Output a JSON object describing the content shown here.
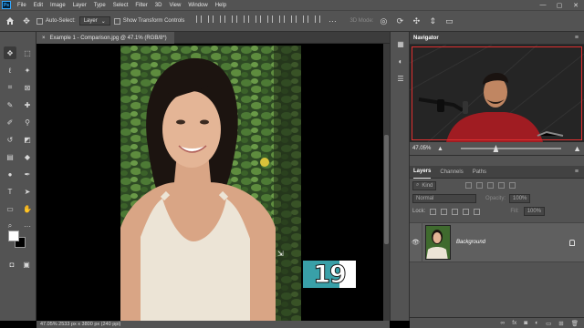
{
  "app": {
    "logo": "Ps"
  },
  "menu": [
    "File",
    "Edit",
    "Image",
    "Layer",
    "Type",
    "Select",
    "Filter",
    "3D",
    "View",
    "Window",
    "Help"
  ],
  "window_controls": {
    "minimize": "—",
    "maximize": "▢",
    "close": "✕"
  },
  "options": {
    "auto_select_label": "Auto-Select:",
    "auto_select_value": "Layer",
    "transform_label": "Show Transform Controls",
    "mode_3d": "3D Mode:"
  },
  "document": {
    "tab_title": "Example 1 - Comparison.jpg @ 47.1% (RGB/8*)",
    "close": "×"
  },
  "status": {
    "text": "47.05%   2533 px x 3800 px (240 ppi)"
  },
  "navigator": {
    "title": "Navigator",
    "zoom": "47.05%",
    "zoom_fraction": 0.35
  },
  "layers_panel": {
    "tabs": [
      "Layers",
      "Channels",
      "Paths"
    ],
    "active_tab": "Layers",
    "filter_label": "Kind",
    "blend_mode": "Normal",
    "opacity_label": "Opacity:",
    "opacity_value": "100%",
    "lock_label": "Lock:",
    "fill_label": "Fill:",
    "fill_value": "100%",
    "layers": [
      {
        "name": "Background",
        "visible": true,
        "locked": true
      }
    ]
  },
  "overlay": {
    "number": "19"
  },
  "colors": {
    "accent_teal": "#39a0a8",
    "purple_line": "#7b40e0",
    "panel_bg": "#535353"
  }
}
